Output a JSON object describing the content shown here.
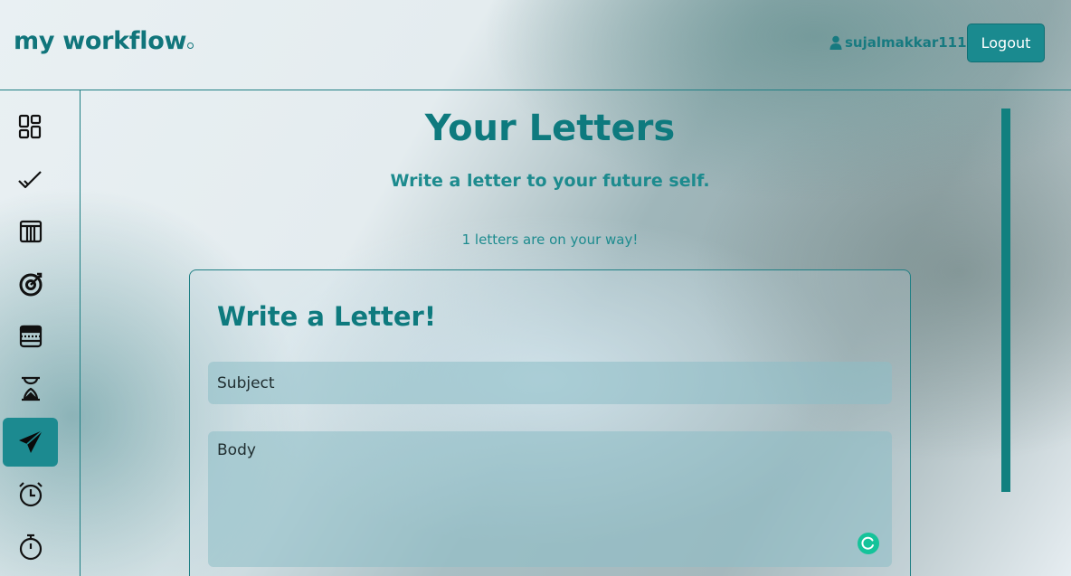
{
  "app": {
    "logo": "my workflow",
    "username": "sujalmakkar1111",
    "logout_label": "Logout"
  },
  "sidebar": {
    "items": [
      {
        "icon": "dashboard-icon",
        "active": false
      },
      {
        "icon": "checkmark-icon",
        "active": false
      },
      {
        "icon": "table-icon",
        "active": false
      },
      {
        "icon": "target-icon",
        "active": false
      },
      {
        "icon": "notes-icon",
        "active": false
      },
      {
        "icon": "hourglass-icon",
        "active": false
      },
      {
        "icon": "paper-plane-icon",
        "active": true
      },
      {
        "icon": "alarm-clock-icon",
        "active": false
      },
      {
        "icon": "stopwatch-icon",
        "active": false
      }
    ]
  },
  "main": {
    "title": "Your Letters",
    "subtitle": "Write a letter to your future self.",
    "count_text": "1 letters are on your way!"
  },
  "form": {
    "title": "Write a Letter!",
    "subject_placeholder": "Subject",
    "body_placeholder": "Body"
  },
  "colors": {
    "accent": "#1a8a8f",
    "text_teal": "#0e7a7e",
    "grammar_badge": "#15c39a"
  }
}
